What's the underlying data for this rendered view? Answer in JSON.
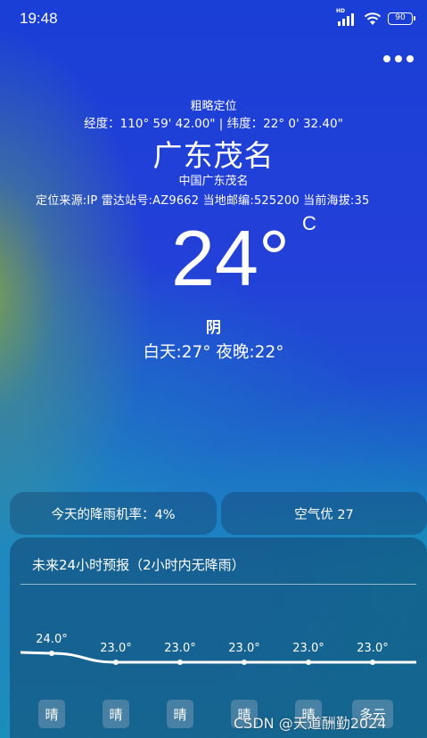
{
  "status_bar": {
    "time": "19:48",
    "hd_label": "HD",
    "battery": "90"
  },
  "location": {
    "accuracy_label": "粗略定位",
    "coordinates": "经度：110° 59' 42.00\" | 纬度：22° 0' 32.40\"",
    "city": "广东茂名",
    "region": "中国广东茂名",
    "meta": "定位来源:IP  雷达站号:AZ9662  当地邮编:525200  当前海拔:35"
  },
  "current": {
    "temperature": "24°",
    "unit": "C",
    "condition": "阴",
    "day_night": "白天:27°  夜晚:22°"
  },
  "cards": {
    "rain_probability": "今天的降雨机率：4%",
    "air_quality": "空气优 27"
  },
  "forecast": {
    "title": "未来24小时预报（2小时内无降雨）",
    "points": [
      {
        "temp": 24.0,
        "label": "24.0°",
        "weather": "晴"
      },
      {
        "temp": 23.0,
        "label": "23.0°",
        "weather": "晴"
      },
      {
        "temp": 23.0,
        "label": "23.0°",
        "weather": "晴"
      },
      {
        "temp": 23.0,
        "label": "23.0°",
        "weather": "晴"
      },
      {
        "temp": 23.0,
        "label": "23.0°",
        "weather": "晴"
      },
      {
        "temp": 23.0,
        "label": "23.0°",
        "weather": "多云"
      }
    ],
    "line_color": "#ffffff"
  },
  "watermark": "CSDN @天道酬勤2024"
}
